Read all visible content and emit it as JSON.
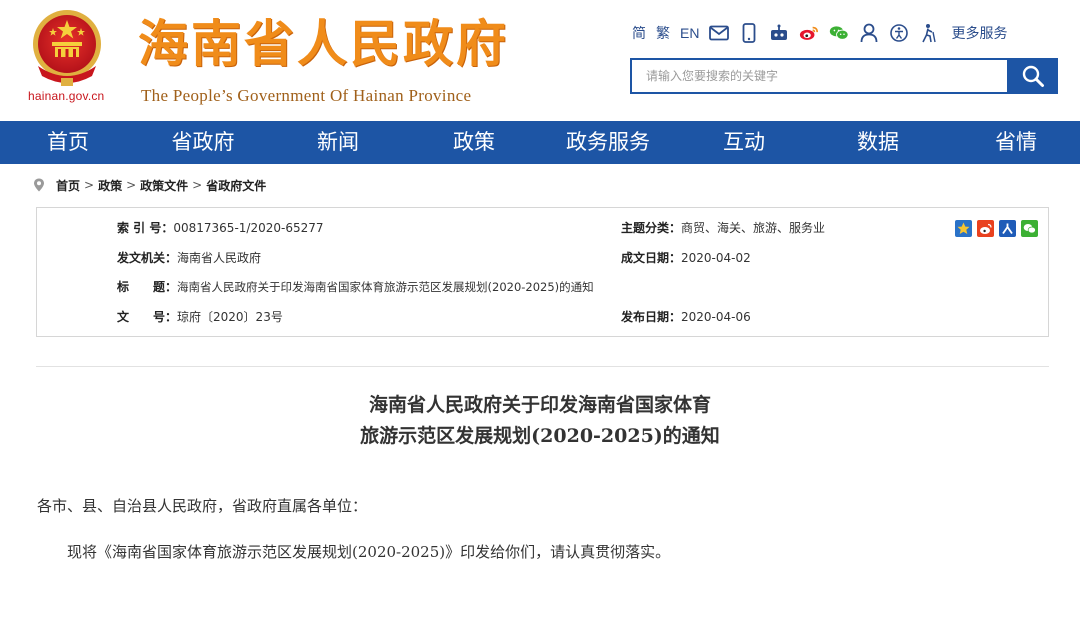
{
  "header": {
    "domain": "hainan.gov.cn",
    "title": "海南省人民政府",
    "subtitle": "The People’s Government Of Hainan Province",
    "lang_simplified": "简",
    "lang_traditional": "繁",
    "lang_english": "EN",
    "icons": [
      "mail-icon",
      "mobile-icon",
      "robot-icon",
      "weibo-icon",
      "wechat-icon",
      "user-icon",
      "accessibility-icon",
      "elderly-mode-icon"
    ],
    "more_services": "更多服务",
    "search_placeholder": "请输入您要搜索的关键字"
  },
  "nav": {
    "items": [
      {
        "label": "首页"
      },
      {
        "label": "省政府"
      },
      {
        "label": "新闻"
      },
      {
        "label": "政策"
      },
      {
        "label": "政务服务"
      },
      {
        "label": "互动"
      },
      {
        "label": "数据"
      },
      {
        "label": "省情"
      }
    ]
  },
  "breadcrumb": [
    "首页",
    "政策",
    "政策文件",
    "省政府文件"
  ],
  "info": {
    "index_label": "索 引 号：",
    "index_value": "00817365-1/2020-65277",
    "topic_label": "主题分类：",
    "topic_value": "商贸、海关、旅游、服务业",
    "issuer_label": "发文机关：",
    "issuer_value": "海南省人民政府",
    "date_made_label": "成文日期：",
    "date_made_value": "2020-04-02",
    "title_label": "标　　题：",
    "title_value": "海南省人民政府关于印发海南省国家体育旅游示范区发展规划(2020-2025)的通知",
    "docno_label": "文　　号：",
    "docno_value": "琼府〔2020〕23号",
    "pub_date_label": "发布日期：",
    "pub_date_value": "2020-04-06"
  },
  "document": {
    "title_line1": "海南省人民政府关于印发海南省国家体育",
    "title_line2": "旅游示范区发展规划(2020-2025)的通知",
    "salutation": "各市、县、自治县人民政府，省政府直属各单位：",
    "body": "现将《海南省国家体育旅游示范区发展规划(2020-2025)》印发给你们，请认真贯彻落实。"
  },
  "colors": {
    "nav_blue": "#1d55a5",
    "title_orange": "#f08c1a",
    "emblem_red": "#c8161d"
  }
}
